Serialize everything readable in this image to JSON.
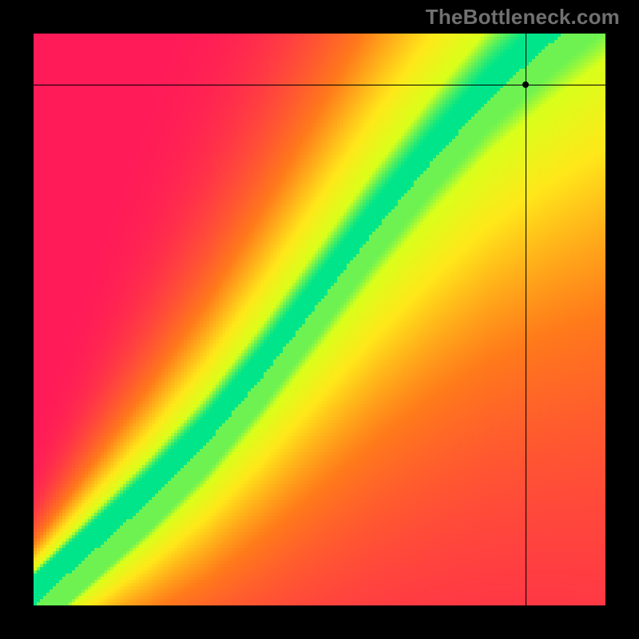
{
  "watermark": "TheBottleneck.com",
  "chart_data": {
    "type": "heatmap",
    "title": "",
    "xlabel": "",
    "ylabel": "",
    "xlim": [
      0,
      100
    ],
    "ylim": [
      0,
      100
    ],
    "grid": false,
    "legend": false,
    "marker": {
      "x": 86,
      "y": 91
    },
    "ideal_curve": {
      "description": "Green band — GPU-vs-CPU sweet-spot midline; y is optimal relative GPU score per relative CPU score x",
      "points": [
        {
          "x": 0,
          "y": 0
        },
        {
          "x": 10,
          "y": 9
        },
        {
          "x": 20,
          "y": 18
        },
        {
          "x": 30,
          "y": 28
        },
        {
          "x": 40,
          "y": 40
        },
        {
          "x": 50,
          "y": 53
        },
        {
          "x": 60,
          "y": 66
        },
        {
          "x": 70,
          "y": 78
        },
        {
          "x": 80,
          "y": 89
        },
        {
          "x": 90,
          "y": 98
        },
        {
          "x": 100,
          "y": 106
        }
      ],
      "band_half_width": 5
    },
    "color_scale": [
      {
        "value": 0.0,
        "color": "#ff1a58"
      },
      {
        "value": 0.45,
        "color": "#ff7a1a"
      },
      {
        "value": 0.75,
        "color": "#ffe71a"
      },
      {
        "value": 0.92,
        "color": "#d9ff1a"
      },
      {
        "value": 1.0,
        "color": "#00e58a"
      }
    ],
    "heatmap_resolution": 179
  }
}
